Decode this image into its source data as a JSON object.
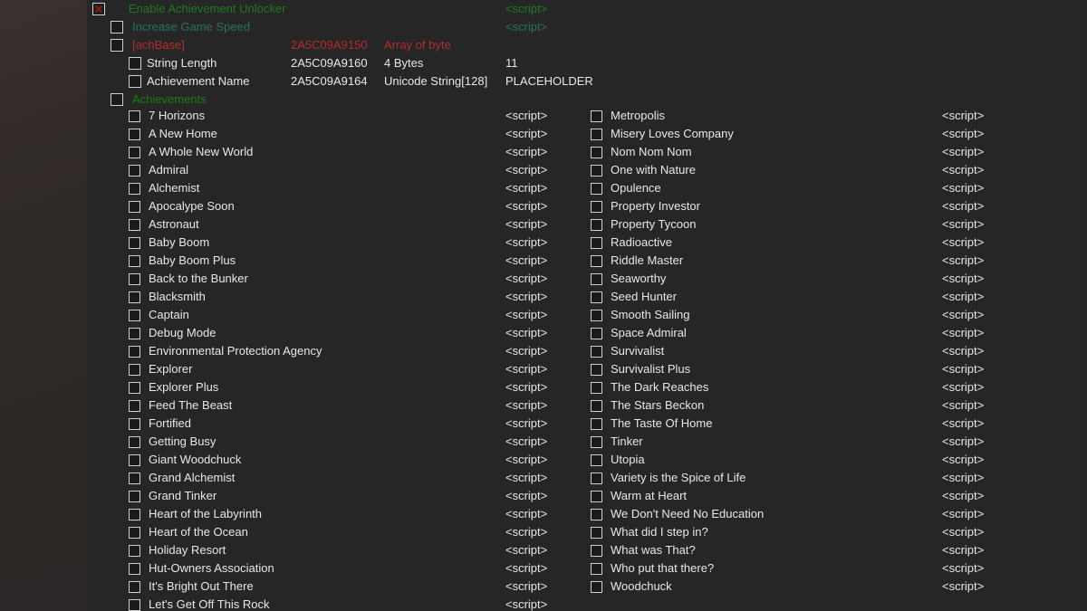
{
  "window": {
    "background_color": "#262626",
    "gutter_color": "#332c2a"
  },
  "colors": {
    "enabled_green": "#1f7a1f",
    "teal": "#2d6f64",
    "red": "#b52b2b",
    "text_white": "#e8e8e8",
    "checkbox_border": "#cfcfcf",
    "x_mark": "#8f1c1c"
  },
  "script_label": "<script>",
  "header_rows": [
    {
      "label": "Enable Achievement Unlocker",
      "color_class": "c-green",
      "indent": 0,
      "checkbox": "checked-x",
      "script": "<script>",
      "script_color": "c-green",
      "address": "",
      "type": "",
      "value": ""
    },
    {
      "label": "Increase Game Speed",
      "color_class": "c-teal",
      "indent": 1,
      "checkbox": "unchecked",
      "script": "<script>",
      "script_color": "c-teal",
      "address": "",
      "type": "",
      "value": ""
    },
    {
      "label": "[achBase]",
      "color_class": "c-red",
      "indent": 1,
      "checkbox": "unchecked",
      "script": "",
      "script_color": "",
      "address": "2A5C09A9150",
      "type": "Array of byte",
      "value": ""
    },
    {
      "label": "String Length",
      "color_class": "c-white",
      "indent": 2,
      "checkbox": "unchecked",
      "script": "",
      "script_color": "",
      "address": "2A5C09A9160",
      "type": "4 Bytes",
      "value": "11"
    },
    {
      "label": "Achievement Name",
      "color_class": "c-white",
      "indent": 2,
      "checkbox": "unchecked",
      "script": "",
      "script_color": "",
      "address": "2A5C09A9164",
      "type": "Unicode String[128]",
      "value": "PLACEHOLDER"
    },
    {
      "label": "Achievements",
      "color_class": "c-green",
      "indent": 1,
      "checkbox": "unchecked",
      "script": "",
      "script_color": "",
      "address": "",
      "type": "",
      "value": ""
    }
  ],
  "achievements_left": [
    "7 Horizons",
    "A New Home",
    "A Whole New World",
    "Admiral",
    "Alchemist",
    "Apocalype Soon",
    "Astronaut",
    "Baby Boom",
    "Baby Boom Plus",
    "Back to the Bunker",
    "Blacksmith",
    "Captain",
    "Debug Mode",
    "Environmental Protection Agency",
    "Explorer",
    "Explorer Plus",
    "Feed The Beast",
    "Fortified",
    "Getting Busy",
    "Giant Woodchuck",
    "Grand Alchemist",
    "Grand Tinker",
    "Heart of the Labyrinth",
    "Heart of the Ocean",
    "Holiday Resort",
    "Hut-Owners Association",
    "It's Bright Out There",
    "Let's Get Off This Rock"
  ],
  "achievements_right": [
    "Metropolis",
    "Misery Loves Company",
    "Nom Nom Nom",
    "One with Nature",
    "Opulence",
    "Property Investor",
    "Property Tycoon",
    "Radioactive",
    "Riddle Master",
    "Seaworthy",
    "Seed Hunter",
    "Smooth Sailing",
    "Space Admiral",
    "Survivalist",
    "Survivalist Plus",
    "The Dark Reaches",
    "The Stars Beckon",
    "The Taste Of Home",
    "Tinker",
    "Utopia",
    "Variety is the Spice of Life",
    "Warm at Heart",
    "We Don't Need No Education",
    "What did I step in?",
    "What was That?",
    "Who put that there?",
    "Woodchuck"
  ]
}
